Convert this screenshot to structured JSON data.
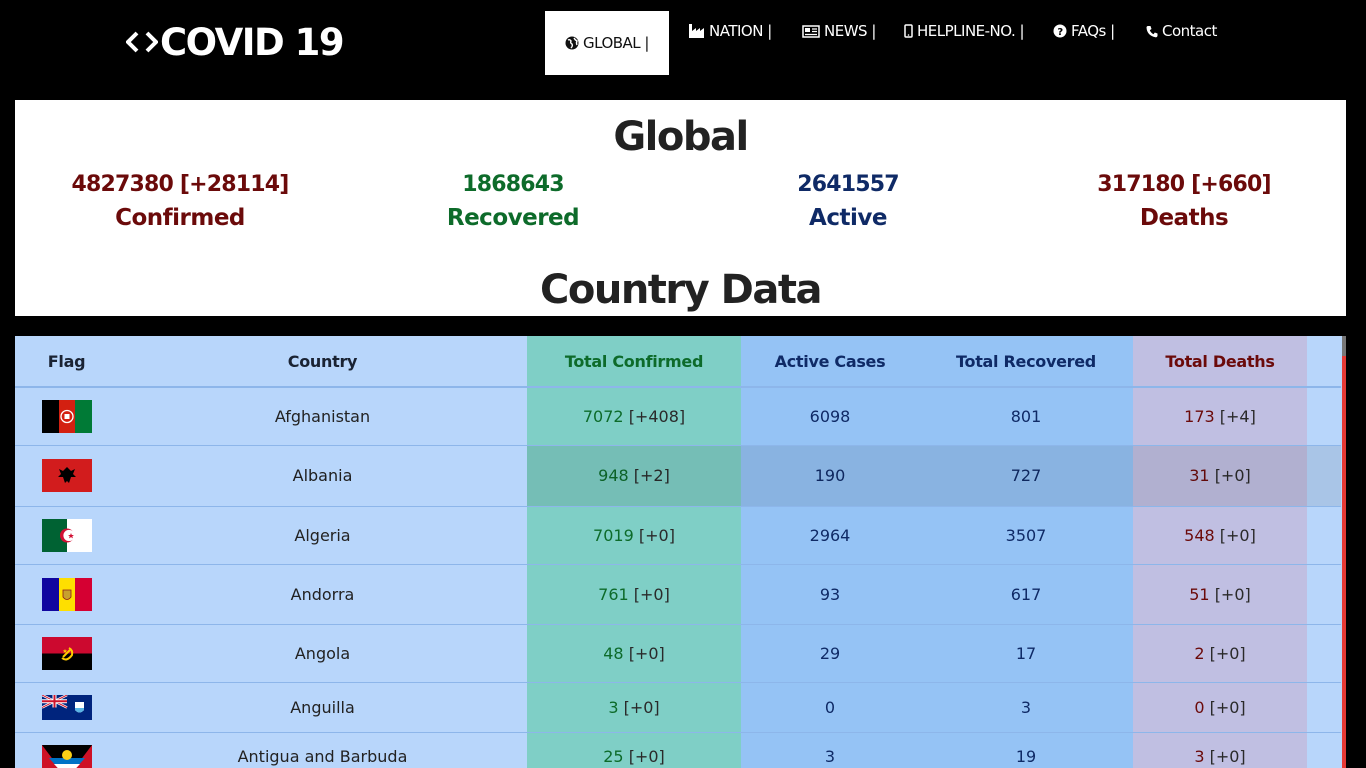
{
  "brand": {
    "text": "COVID 19",
    "icon": "code-brackets-icon"
  },
  "nav": {
    "global": "GLOBAL |",
    "nation": "NATION |",
    "news": "NEWS |",
    "helpline": "HELPLINE-NO. |",
    "faqs": "FAQs |",
    "contact": "Contact"
  },
  "global": {
    "title": "Global",
    "confirmed_value": "4827380 [+28114]",
    "confirmed_label": "Confirmed",
    "recovered_value": "1868643",
    "recovered_label": "Recovered",
    "active_value": "2641557",
    "active_label": "Active",
    "deaths_value": "317180 [+660]",
    "deaths_label": "Deaths"
  },
  "country_section": {
    "title": "Country Data"
  },
  "table": {
    "headers": {
      "flag": "Flag",
      "country": "Country",
      "confirmed": "Total Confirmed",
      "active": "Active Cases",
      "recovered": "Total Recovered",
      "deaths": "Total Deaths"
    },
    "rows": [
      {
        "country": "Afghanistan",
        "confirmed": "7072",
        "confirmed_delta": "[+408]",
        "active": "6098",
        "recovered": "801",
        "deaths": "173",
        "deaths_delta": "[+4]"
      },
      {
        "country": "Albania",
        "confirmed": "948",
        "confirmed_delta": "[+2]",
        "active": "190",
        "recovered": "727",
        "deaths": "31",
        "deaths_delta": "[+0]"
      },
      {
        "country": "Algeria",
        "confirmed": "7019",
        "confirmed_delta": "[+0]",
        "active": "2964",
        "recovered": "3507",
        "deaths": "548",
        "deaths_delta": "[+0]"
      },
      {
        "country": "Andorra",
        "confirmed": "761",
        "confirmed_delta": "[+0]",
        "active": "93",
        "recovered": "617",
        "deaths": "51",
        "deaths_delta": "[+0]"
      },
      {
        "country": "Angola",
        "confirmed": "48",
        "confirmed_delta": "[+0]",
        "active": "29",
        "recovered": "17",
        "deaths": "2",
        "deaths_delta": "[+0]"
      },
      {
        "country": "Anguilla",
        "confirmed": "3",
        "confirmed_delta": "[+0]",
        "active": "0",
        "recovered": "3",
        "deaths": "0",
        "deaths_delta": "[+0]"
      },
      {
        "country": "Antigua and Barbuda",
        "confirmed": "25",
        "confirmed_delta": "[+0]",
        "active": "3",
        "recovered": "19",
        "deaths": "3",
        "deaths_delta": "[+0]"
      }
    ]
  },
  "colors": {
    "confirmed": "#6b0a0a",
    "recovered": "#0d6b2a",
    "active": "#0f2a66",
    "deaths": "#6b0a0a",
    "scrollbar": "#e53935"
  }
}
